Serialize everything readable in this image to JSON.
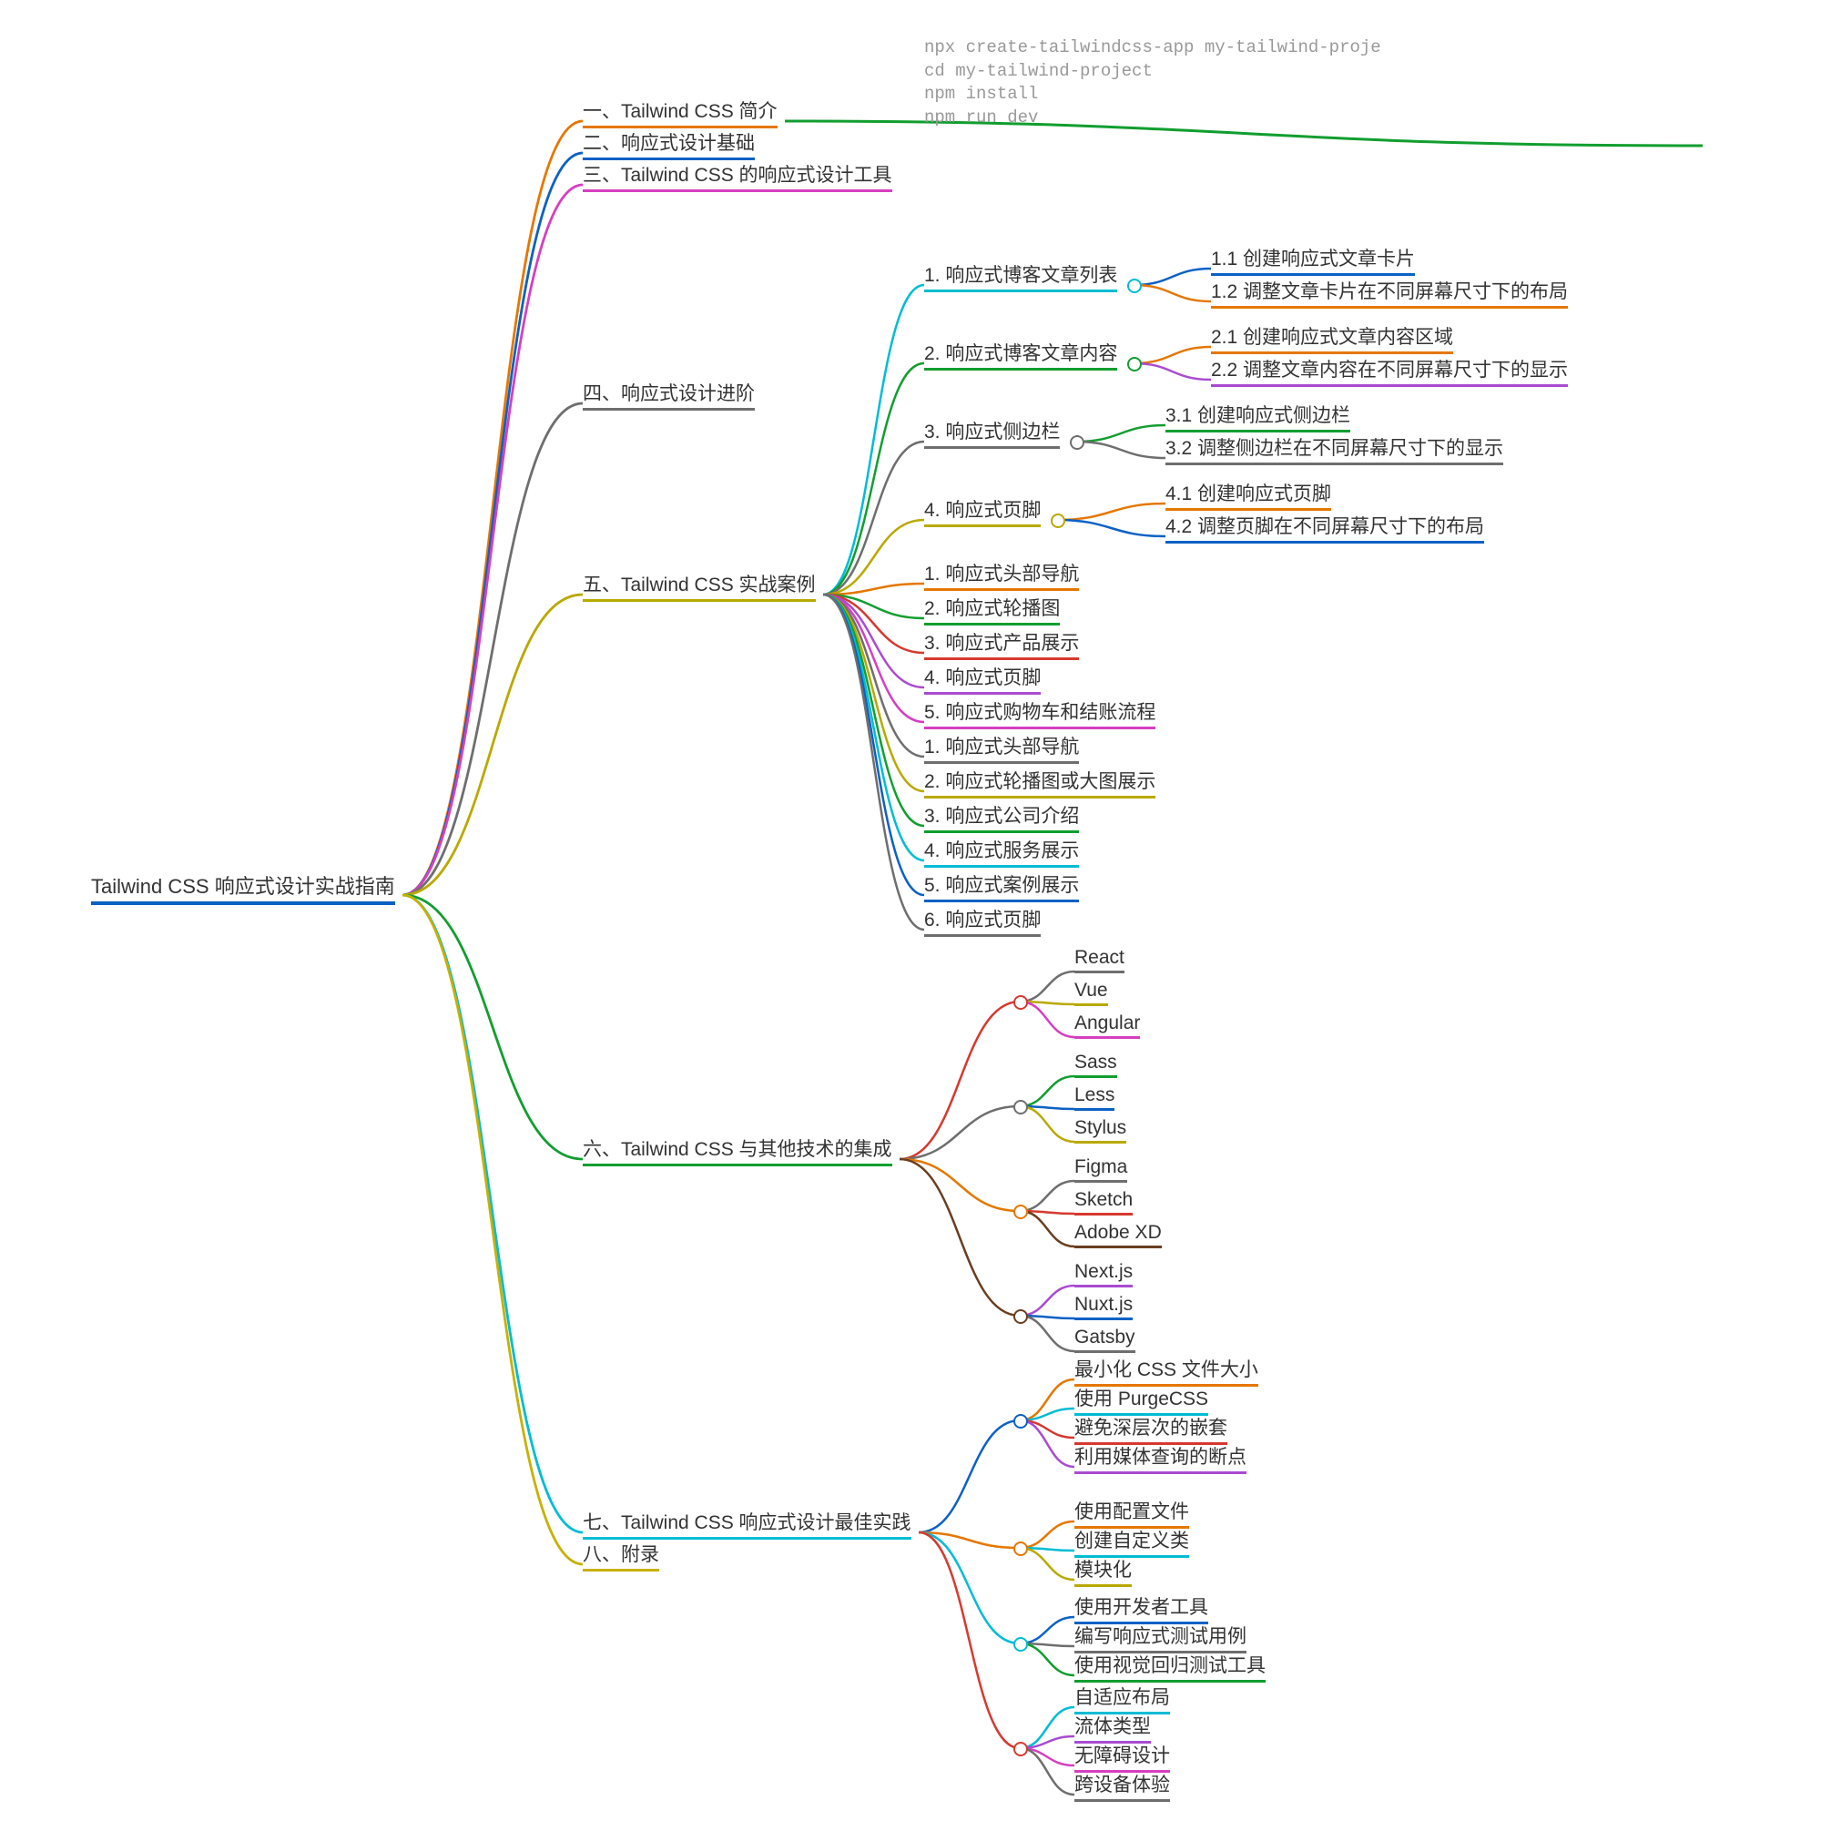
{
  "root": {
    "label": "Tailwind CSS 响应式设计实战指南",
    "color": "#0b61c4"
  },
  "code": [
    "npx create-tailwindcss-app my-tailwind-proje",
    "cd my-tailwind-project",
    "npm install",
    "npm run dev"
  ],
  "level1": [
    {
      "label": "一、Tailwind CSS 简介",
      "color": "#e57700"
    },
    {
      "label": "二、响应式设计基础",
      "color": "#0b61c4"
    },
    {
      "label": "三、Tailwind CSS 的响应式设计工具",
      "color": "#d63fc1"
    },
    {
      "label": "四、响应式设计进阶",
      "color": "#6e6e6e"
    },
    {
      "label": "五、Tailwind CSS 实战案例",
      "color": "#b9a900"
    },
    {
      "label": "六、Tailwind CSS 与其他技术的集成",
      "color": "#119e2f"
    },
    {
      "label": "七、Tailwind CSS 响应式设计最佳实践",
      "color": "#00bcd4"
    },
    {
      "label": "八、附录",
      "color": "#c7b100"
    }
  ],
  "case5": [
    {
      "label": "1. 响应式博客文章列表",
      "color": "#00bcd4",
      "children": [
        {
          "label": "1.1 创建响应式文章卡片",
          "color": "#0b61c4"
        },
        {
          "label": "1.2 调整文章卡片在不同屏幕尺寸下的布局",
          "color": "#e57700"
        }
      ]
    },
    {
      "label": "2. 响应式博客文章内容",
      "color": "#119e2f",
      "children": [
        {
          "label": "2.1 创建响应式文章内容区域",
          "color": "#e57700"
        },
        {
          "label": "2.2 调整文章内容在不同屏幕尺寸下的显示",
          "color": "#a94bd1"
        }
      ]
    },
    {
      "label": "3. 响应式侧边栏",
      "color": "#6e6e6e",
      "children": [
        {
          "label": "3.1 创建响应式侧边栏",
          "color": "#119e2f"
        },
        {
          "label": "3.2 调整侧边栏在不同屏幕尺寸下的显示",
          "color": "#6e6e6e"
        }
      ]
    },
    {
      "label": "4. 响应式页脚",
      "color": "#b9a900",
      "children": [
        {
          "label": "4.1 创建响应式页脚",
          "color": "#e57700"
        },
        {
          "label": "4.2 调整页脚在不同屏幕尺寸下的布局",
          "color": "#0b61c4"
        }
      ]
    },
    {
      "label": "1. 响应式头部导航",
      "color": "#e57700"
    },
    {
      "label": "2. 响应式轮播图",
      "color": "#119e2f"
    },
    {
      "label": "3. 响应式产品展示",
      "color": "#d6392f"
    },
    {
      "label": "4. 响应式页脚",
      "color": "#a94bd1"
    },
    {
      "label": "5. 响应式购物车和结账流程",
      "color": "#d63fc1"
    },
    {
      "label": "1. 响应式头部导航",
      "color": "#6e6e6e"
    },
    {
      "label": "2. 响应式轮播图或大图展示",
      "color": "#b9a900"
    },
    {
      "label": "3. 响应式公司介绍",
      "color": "#119e2f"
    },
    {
      "label": "4. 响应式服务展示",
      "color": "#00bcd4"
    },
    {
      "label": "5. 响应式案例展示",
      "color": "#0b61c4"
    },
    {
      "label": "6. 响应式页脚",
      "color": "#6e6e6e"
    }
  ],
  "tech6": [
    {
      "color": "#d6392f",
      "items": [
        {
          "label": "React",
          "color": "#6e6e6e"
        },
        {
          "label": "Vue",
          "color": "#b9a900"
        },
        {
          "label": "Angular",
          "color": "#d63fc1"
        }
      ]
    },
    {
      "color": "#6e6e6e",
      "items": [
        {
          "label": "Sass",
          "color": "#119e2f"
        },
        {
          "label": "Less",
          "color": "#0b61c4"
        },
        {
          "label": "Stylus",
          "color": "#b9a900"
        }
      ]
    },
    {
      "color": "#e57700",
      "items": [
        {
          "label": "Figma",
          "color": "#6e6e6e"
        },
        {
          "label": "Sketch",
          "color": "#d6392f"
        },
        {
          "label": "Adobe XD",
          "color": "#6a3e1f"
        }
      ]
    },
    {
      "color": "#6a3e1f",
      "items": [
        {
          "label": "Next.js",
          "color": "#a94bd1"
        },
        {
          "label": "Nuxt.js",
          "color": "#0b61c4"
        },
        {
          "label": "Gatsby",
          "color": "#6e6e6e"
        }
      ]
    }
  ],
  "best7": [
    {
      "color": "#0b61c4",
      "items": [
        {
          "label": "最小化 CSS 文件大小",
          "color": "#e57700"
        },
        {
          "label": "使用 PurgeCSS",
          "color": "#00bcd4"
        },
        {
          "label": "避免深层次的嵌套",
          "color": "#d6392f"
        },
        {
          "label": "利用媒体查询的断点",
          "color": "#a94bd1"
        }
      ]
    },
    {
      "color": "#e57700",
      "items": [
        {
          "label": "使用配置文件",
          "color": "#e57700"
        },
        {
          "label": "创建自定义类",
          "color": "#00bcd4"
        },
        {
          "label": "模块化",
          "color": "#b9a900"
        }
      ]
    },
    {
      "color": "#00bcd4",
      "items": [
        {
          "label": "使用开发者工具",
          "color": "#0b61c4"
        },
        {
          "label": "编写响应式测试用例",
          "color": "#6e6e6e"
        },
        {
          "label": "使用视觉回归测试工具",
          "color": "#119e2f"
        }
      ]
    },
    {
      "color": "#d6392f",
      "items": [
        {
          "label": "自适应布局",
          "color": "#00bcd4"
        },
        {
          "label": "流体类型",
          "color": "#a94bd1"
        },
        {
          "label": "无障碍设计",
          "color": "#d63fc1"
        },
        {
          "label": "跨设备体验",
          "color": "#6e6e6e"
        }
      ]
    }
  ]
}
